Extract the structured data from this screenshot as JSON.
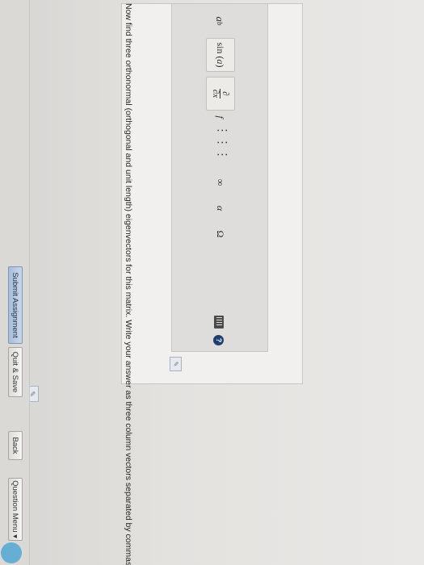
{
  "question": {
    "prompt": "Now find three orthonormal (orthogonal and unit length) eigenvectors for this matrix. Write your answer as three column vectors separated by commas."
  },
  "toolbar": {
    "power_base": "a",
    "power_exp": "b",
    "sin_fn": "sin",
    "sin_arg": "a",
    "partial_num": "∂",
    "partial_den": "∂x",
    "partial_f": "f",
    "matrix_glyph": "⋮⋮⋮",
    "infinity": "∞",
    "alpha": "α",
    "omega": "Ω",
    "help": "?"
  },
  "buttons": {
    "submit": "Submit Assignment",
    "quit": "Quit & Save",
    "back": "Back",
    "menu": "Question Menu ▾"
  },
  "colors": {
    "primary_button": "#a9bdd8",
    "help_icon": "#1f3f73",
    "cursor": "#5aa8d4"
  }
}
